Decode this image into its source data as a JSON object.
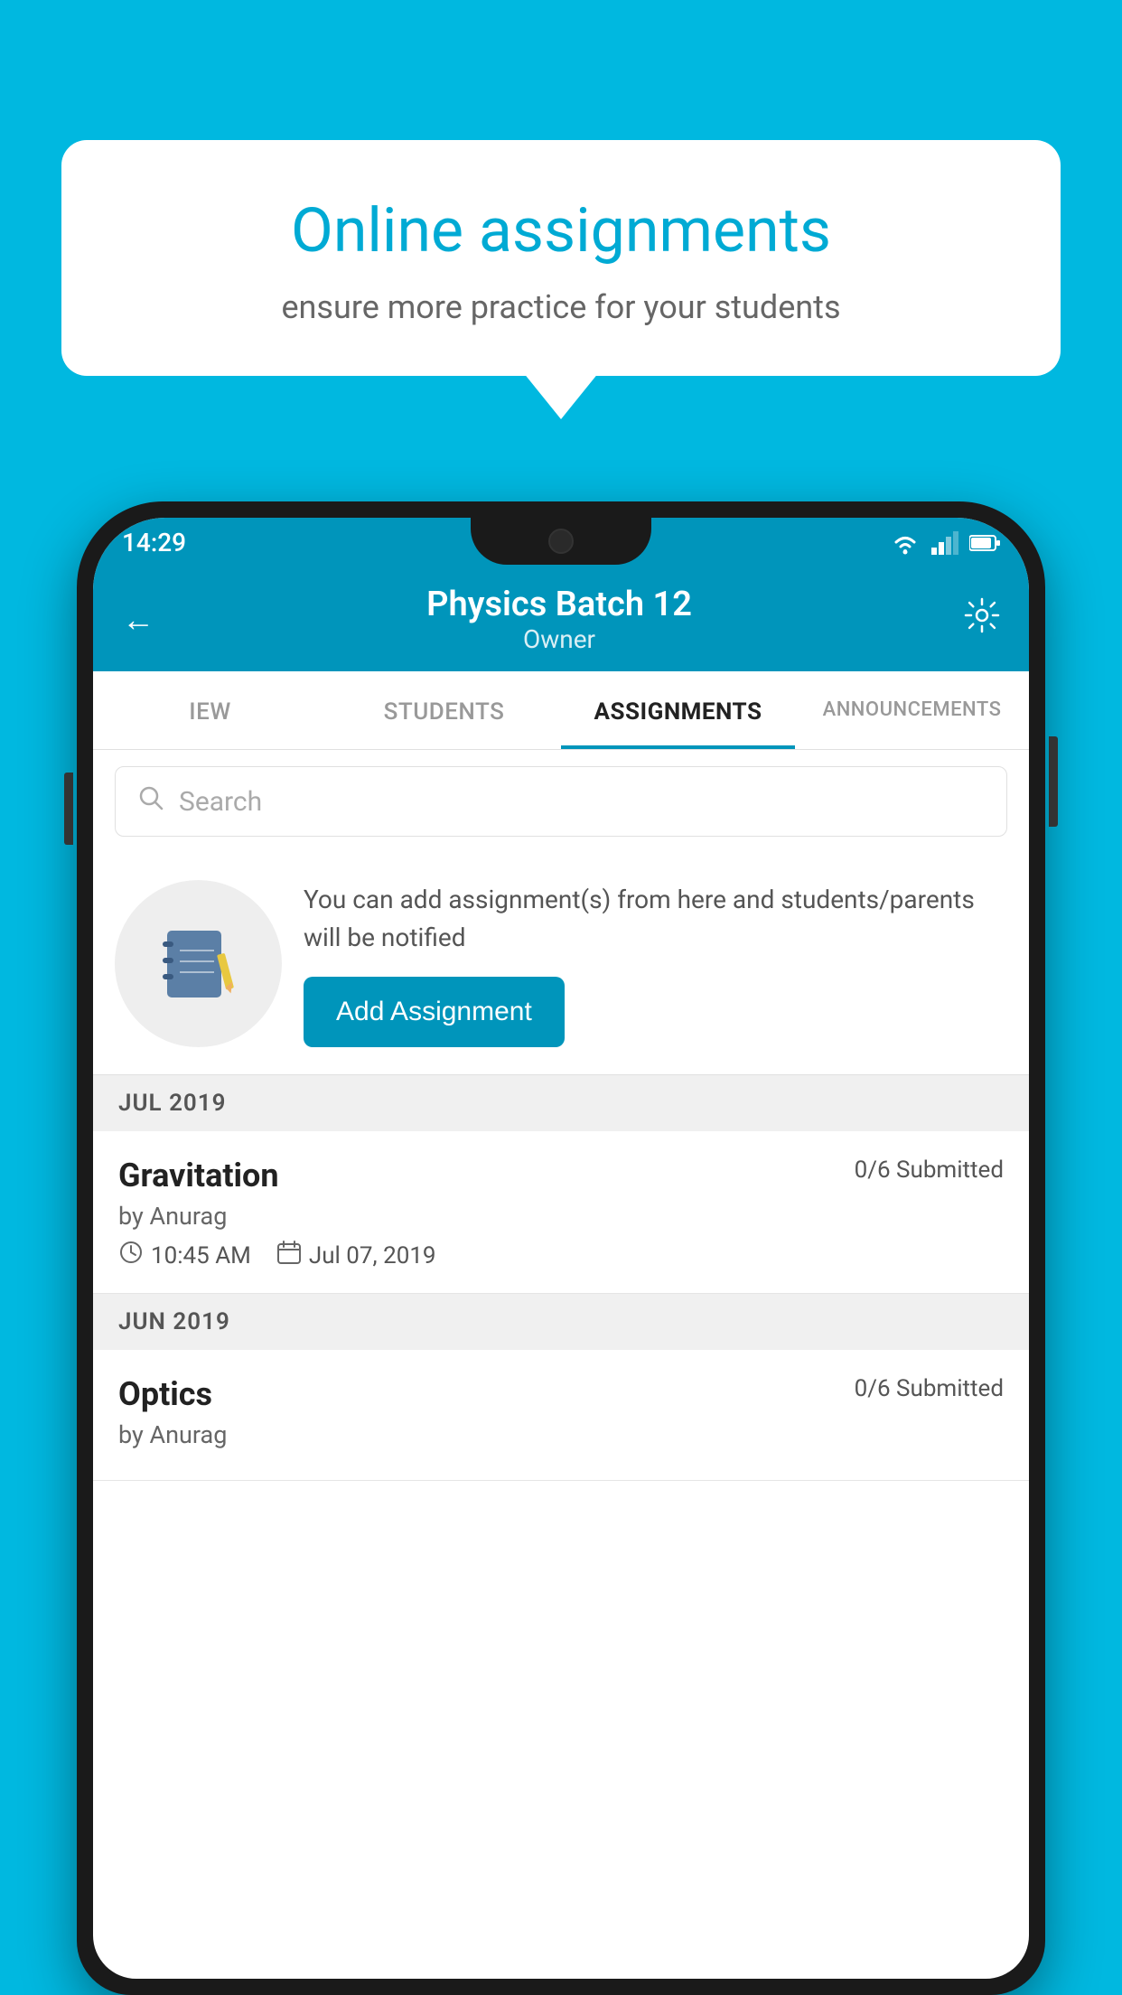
{
  "background_color": "#00b8e0",
  "speech_bubble": {
    "title": "Online assignments",
    "subtitle": "ensure more practice for your students"
  },
  "status_bar": {
    "time": "14:29"
  },
  "header": {
    "title": "Physics Batch 12",
    "subtitle": "Owner",
    "back_label": "←",
    "settings_label": "⚙"
  },
  "tabs": [
    {
      "label": "IEW",
      "active": false
    },
    {
      "label": "STUDENTS",
      "active": false
    },
    {
      "label": "ASSIGNMENTS",
      "active": true
    },
    {
      "label": "ANNOUNCEMENTS",
      "active": false
    }
  ],
  "search": {
    "placeholder": "Search"
  },
  "promo": {
    "text": "You can add assignment(s) from here and students/parents will be notified",
    "button_label": "Add Assignment"
  },
  "sections": [
    {
      "label": "JUL 2019",
      "assignments": [
        {
          "name": "Gravitation",
          "submitted": "0/6 Submitted",
          "by": "by Anurag",
          "time": "10:45 AM",
          "date": "Jul 07, 2019"
        }
      ]
    },
    {
      "label": "JUN 2019",
      "assignments": [
        {
          "name": "Optics",
          "submitted": "0/6 Submitted",
          "by": "by Anurag",
          "time": "",
          "date": ""
        }
      ]
    }
  ]
}
